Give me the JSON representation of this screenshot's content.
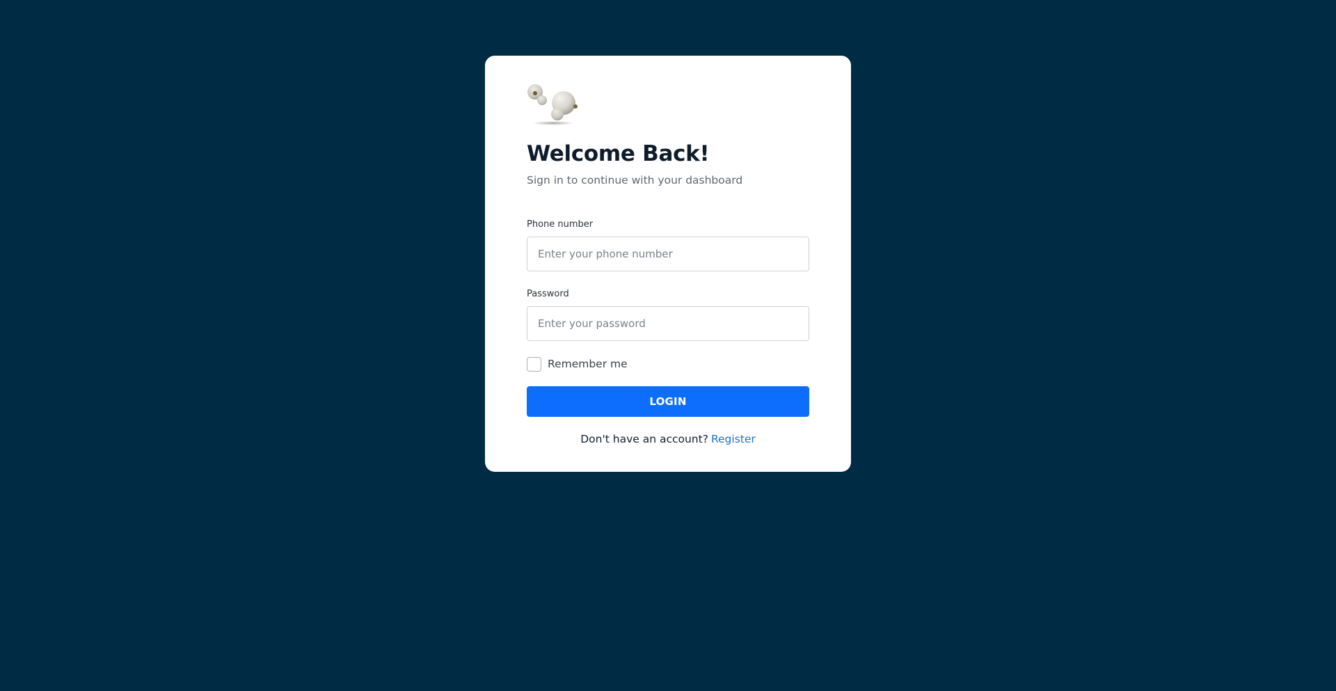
{
  "page": {
    "background_color": "#002b45"
  },
  "logo": {
    "icon": "earbuds-logo-icon"
  },
  "header": {
    "title": "Welcome Back!",
    "subtitle": "Sign in to continue with your dashboard"
  },
  "form": {
    "phone": {
      "label": "Phone number",
      "value": "",
      "placeholder": "Enter your phone number"
    },
    "password": {
      "label": "Password",
      "value": "",
      "placeholder": "Enter your password"
    },
    "remember": {
      "label": "Remember me",
      "checked": false
    },
    "login_label": "LOGIN",
    "login_color": "#0d6efd"
  },
  "footer": {
    "prompt": "Don't have an account?",
    "register_label": "Register",
    "register_color": "#1f6fd1"
  }
}
